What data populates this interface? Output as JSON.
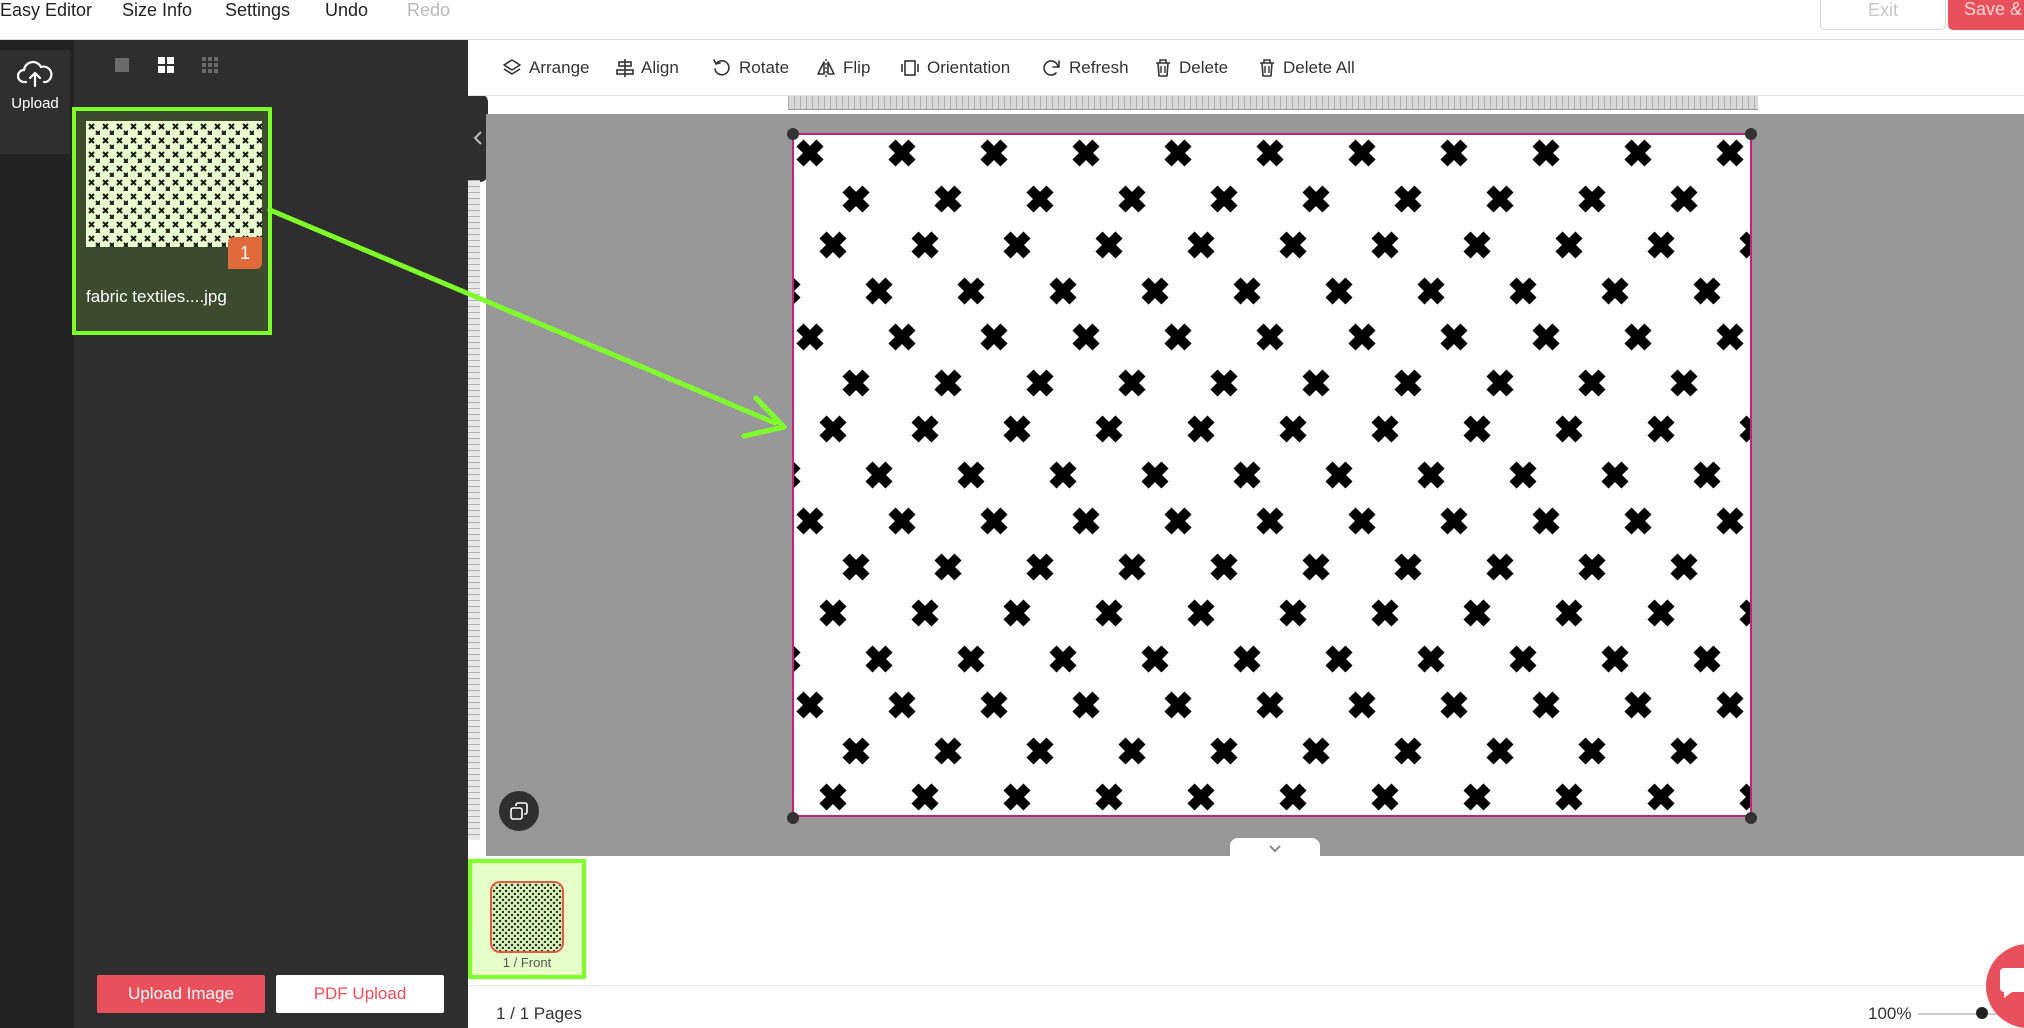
{
  "menu": {
    "app_name": "Easy Editor",
    "size_info": "Size Info",
    "settings": "Settings",
    "undo": "Undo",
    "redo": "Redo",
    "exit": "Exit",
    "save": "Save & C"
  },
  "rail": {
    "upload_label": "Upload",
    "upload_icon": "cloud-upload-icon"
  },
  "library": {
    "view_modes": [
      "single-view-icon",
      "grid-2x2-icon",
      "grid-3x3-icon"
    ],
    "active_view": "grid-2x2-icon",
    "items": [
      {
        "name": "fabric textiles....jpg",
        "usage_count": "1"
      }
    ],
    "upload_image_label": "Upload Image",
    "pdf_upload_label": "PDF Upload"
  },
  "toolbar": {
    "arrange": "Arrange",
    "align": "Align",
    "rotate": "Rotate",
    "flip": "Flip",
    "orientation": "Orientation",
    "refresh": "Refresh",
    "delete": "Delete",
    "delete_all": "Delete All"
  },
  "pages": {
    "thumb_label": "1 / Front",
    "page_count": "1 / 1 Pages",
    "zoom": "100%",
    "zoom_slider_position": 0.6
  },
  "colors": {
    "accent": "#e8505b",
    "highlight": "#7fff2a",
    "selection_border": "#c2237a",
    "badge": "#e06a3a"
  }
}
